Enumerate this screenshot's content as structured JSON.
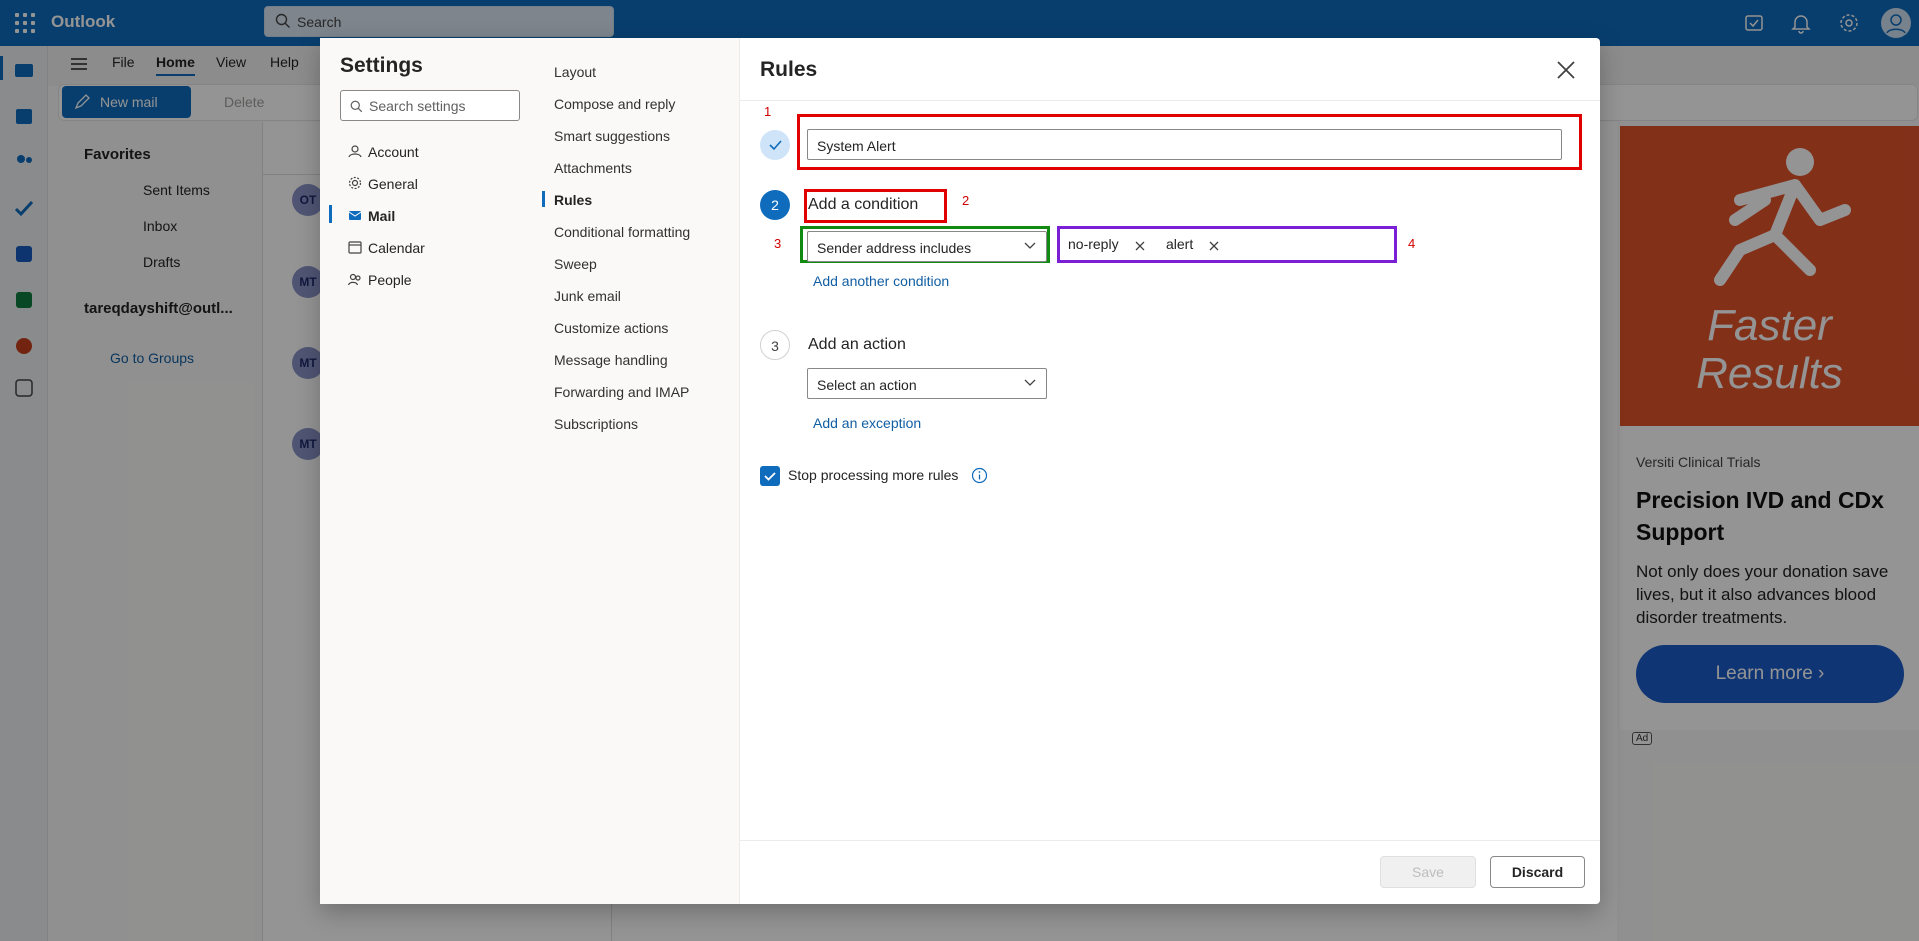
{
  "app": {
    "title": "Outlook",
    "search_placeholder": "Search"
  },
  "ribbon": {
    "tabs": [
      "File",
      "Home",
      "View",
      "Help"
    ],
    "new_mail": "New mail",
    "delete": "Delete"
  },
  "folders": {
    "favorites": "Favorites",
    "items": [
      "Sent Items",
      "Inbox",
      "Drafts"
    ],
    "account": "tareqdayshift@outl...",
    "groups": "Go to Groups"
  },
  "message_list": {
    "avatars": [
      "OT",
      "MT",
      "MT",
      "MT"
    ]
  },
  "ad": {
    "image_text": [
      "Faster",
      "Results"
    ],
    "sponsor": "Versiti Clinical Trials",
    "headline": "Precision IVD and CDx Support",
    "body": "Not only does your donation save lives, but it also advances blood disorder treatments.",
    "cta": "Learn more",
    "badge": "Ad"
  },
  "settings": {
    "title": "Settings",
    "search_placeholder": "Search settings",
    "categories": [
      "Account",
      "General",
      "Mail",
      "Calendar",
      "People"
    ],
    "selected_category": "Mail",
    "mail_subsections": [
      "Layout",
      "Compose and reply",
      "Smart suggestions",
      "Attachments",
      "Rules",
      "Conditional formatting",
      "Sweep",
      "Junk email",
      "Customize actions",
      "Message handling",
      "Forwarding and IMAP",
      "Subscriptions"
    ],
    "selected_subsection": "Rules"
  },
  "rules": {
    "title": "Rules",
    "rule_name": "System Alert",
    "step2_number": "2",
    "condition_heading": "Add a condition",
    "condition_type": "Sender address includes",
    "condition_values": [
      "no-reply",
      "alert"
    ],
    "add_condition_link": "Add another condition",
    "step3_number": "3",
    "action_heading": "Add an action",
    "action_placeholder": "Select an action",
    "add_exception_link": "Add an exception",
    "stop_processing_label": "Stop processing more rules",
    "stop_processing_checked": true,
    "save": "Save",
    "discard": "Discard"
  },
  "annotations": [
    "1",
    "2",
    "3",
    "4"
  ],
  "colors": {
    "brand": "#0f6cbd",
    "annotation_red": "#e00000",
    "annotation_green": "#118a11",
    "annotation_purple": "#7b1fd6"
  }
}
